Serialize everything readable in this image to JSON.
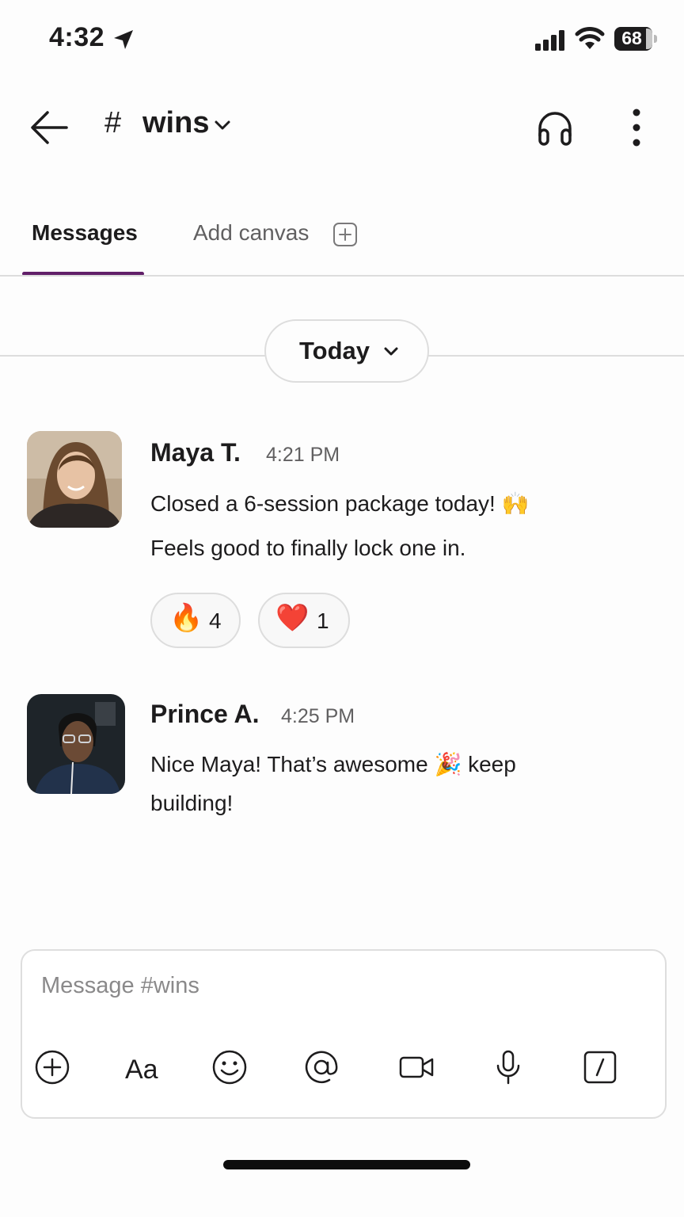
{
  "status_bar": {
    "time": "4:32",
    "battery": "68"
  },
  "header": {
    "hash": "#",
    "channel": "wins"
  },
  "tabs": [
    {
      "label": "Messages"
    },
    {
      "label": "Add canvas"
    }
  ],
  "date_divider": {
    "label": "Today"
  },
  "messages": [
    {
      "author": "Maya T.",
      "time": "4:21 PM",
      "lines": [
        "Closed a 6-session package today! 🙌",
        "Feels good to finally lock one in."
      ],
      "reactions": [
        {
          "emoji": "🔥",
          "count": "4"
        },
        {
          "emoji": "❤️",
          "count": "1"
        }
      ]
    },
    {
      "author": "Prince A.",
      "time": "4:25 PM",
      "lines": [
        "Nice Maya! That’s awesome 🎉 keep",
        "building!"
      ]
    }
  ],
  "composer": {
    "placeholder": "Message #wins"
  },
  "colors": {
    "accent": "#611f69",
    "text": "#1d1c1d",
    "muted": "#616061",
    "border": "#dddddd"
  },
  "icons": [
    "location-arrow-icon",
    "signal-icon",
    "wifi-icon",
    "battery-icon",
    "back-arrow-icon",
    "chevron-down-icon",
    "headphones-icon",
    "more-vertical-icon",
    "plus-square-icon",
    "plus-circle-icon",
    "text-format-icon",
    "emoji-icon",
    "mention-icon",
    "video-icon",
    "microphone-icon",
    "slash-command-icon"
  ]
}
